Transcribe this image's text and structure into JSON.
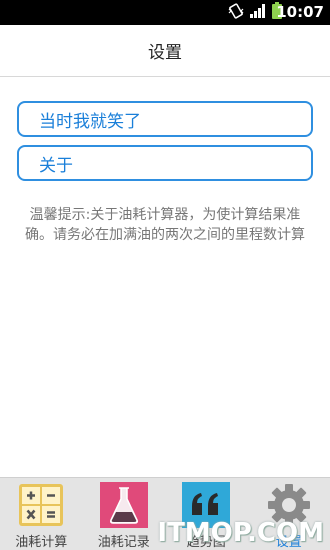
{
  "status_bar": {
    "time": "10:07",
    "icons": [
      "vibrate-icon",
      "signal-icon",
      "battery-icon"
    ]
  },
  "app_bar": {
    "title": "设置"
  },
  "settings": {
    "buttons": [
      {
        "label": "当时我就笑了"
      },
      {
        "label": "关于"
      }
    ],
    "tip": "温馨提示:关于油耗计算器，为使计算结果准确。请务必在加满油的两次之间的里程数计算"
  },
  "tabs": [
    {
      "label": "油耗计算",
      "icon": "calculator-icon",
      "active": false
    },
    {
      "label": "油耗记录",
      "icon": "flask-icon",
      "active": false
    },
    {
      "label": "趋势图",
      "icon": "quote-icon",
      "active": false
    },
    {
      "label": "设置",
      "icon": "gear-icon",
      "active": true
    }
  ],
  "watermark": "ITMOP.COM",
  "colors": {
    "accent": "#1a7fd9",
    "button_border": "#2f8fe0",
    "tab_bar_bg": "#e4e4e4",
    "calculator_icon": "#e8c45a",
    "flask_icon_bg": "#e04a7a",
    "quote_icon_bg": "#2fa8d8",
    "gear_icon": "#8a8a8a"
  }
}
